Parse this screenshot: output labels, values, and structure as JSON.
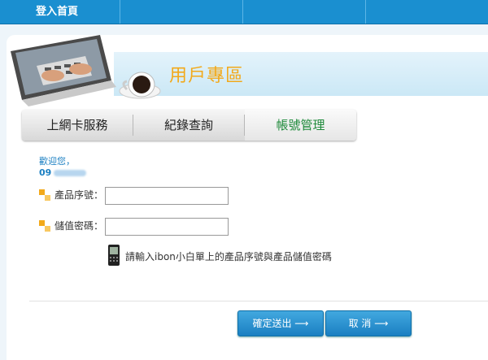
{
  "topnav": {
    "home_label": "登入首頁"
  },
  "header": {
    "title": "用戶專區"
  },
  "tabs": [
    {
      "label": "上網卡服務"
    },
    {
      "label": "紀錄查詢"
    },
    {
      "label": "帳號管理"
    }
  ],
  "account": {
    "greeting": "歡迎您，",
    "phone_prefix": "09"
  },
  "form": {
    "serial_label": "產品序號：",
    "serial_value": "",
    "pin_label": "儲值密碼：",
    "pin_value": "",
    "note": "請輸入ibon小白單上的產品序號與產品儲值密碼"
  },
  "buttons": {
    "confirm": "確定送出 ⟶",
    "cancel": "取 消 ⟶"
  },
  "colors": {
    "topbar": "#1a8fd0",
    "accent": "#f2a91a",
    "active_tab": "#1f8a3b",
    "button": "#1a7fc2"
  }
}
